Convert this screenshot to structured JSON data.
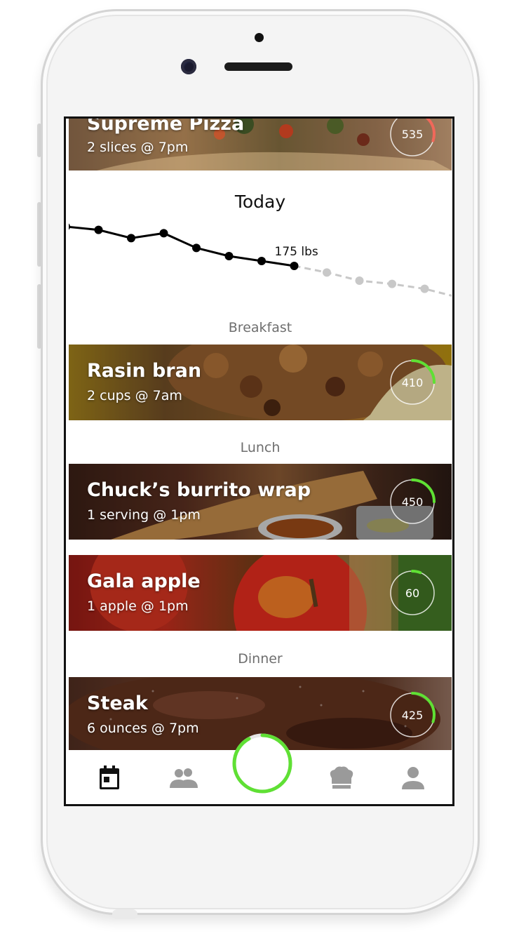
{
  "partial_item": {
    "title": "Supreme Pizza",
    "subtitle": "2 slices @ 7pm",
    "calories": "535",
    "progress": 0.3,
    "ring_color": "#f0685a"
  },
  "weight_chart": {
    "title": "Today",
    "current_label": "175 lbs",
    "chart_data": {
      "type": "line",
      "title": "",
      "series": [
        {
          "name": "",
          "style": "solid",
          "color": "#000000",
          "values": [
            187,
            186,
            183.5,
            185,
            180.5,
            178,
            176.5,
            175
          ]
        },
        {
          "name": "",
          "style": "dashed",
          "color": "#c8c8c8",
          "values": [
            175,
            173,
            170.5,
            169.5,
            168,
            165.5
          ]
        }
      ],
      "ylim": [
        160,
        190
      ],
      "grid": false
    }
  },
  "sections": {
    "breakfast": "Breakfast",
    "lunch": "Lunch",
    "dinner": "Dinner"
  },
  "meals": [
    {
      "title": "Rasin bran",
      "subtitle": "2 cups @ 7am",
      "calories": "410",
      "progress": 0.25,
      "ring_color": "#5fe034"
    },
    {
      "title": "Chuck’s burrito wrap",
      "subtitle": "1 serving @ 1pm",
      "calories": "450",
      "progress": 0.25,
      "ring_color": "#5fe034"
    },
    {
      "title": "Gala apple",
      "subtitle": "1 apple @ 1pm",
      "calories": "60",
      "progress": 0.06,
      "ring_color": "#5fe034"
    },
    {
      "title": "Steak",
      "subtitle": "6 ounces @ 7pm",
      "calories": "425",
      "progress": 0.3,
      "ring_color": "#5fe034"
    }
  ],
  "tabs": [
    {
      "name": "calendar-icon",
      "active": true
    },
    {
      "name": "friends-icon",
      "active": false
    },
    {
      "name": "daily-progress-ring",
      "progress": 0.92,
      "ring_color": "#5fe034"
    },
    {
      "name": "chef-hat-icon",
      "active": false
    },
    {
      "name": "profile-icon",
      "active": false
    }
  ]
}
